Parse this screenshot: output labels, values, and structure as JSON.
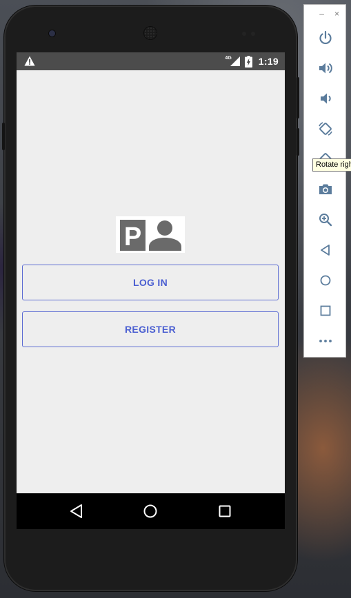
{
  "status_bar": {
    "network_type": "4G",
    "time": "1:19",
    "icons": [
      "warning-icon",
      "signal-icon",
      "battery-charging-icon"
    ]
  },
  "app": {
    "logo_letter": "P",
    "logo_icon": "person-icon",
    "login_label": "LOG IN",
    "register_label": "REGISTER",
    "accent_color": "#4b5fd1",
    "background_color": "#eeeeee"
  },
  "nav_bar": {
    "icons": [
      "back-triangle-icon",
      "home-circle-icon",
      "recents-square-icon"
    ]
  },
  "emulator_toolbar": {
    "window_controls": [
      "–",
      "×"
    ],
    "buttons": [
      "power-icon",
      "volume-up-icon",
      "volume-down-icon",
      "rotate-left-icon",
      "rotate-right-icon",
      "camera-icon",
      "zoom-icon",
      "back-icon",
      "home-icon",
      "overview-icon",
      "more-icon"
    ],
    "icon_color": "#5b7c9c",
    "tooltip": "Rotate right"
  }
}
